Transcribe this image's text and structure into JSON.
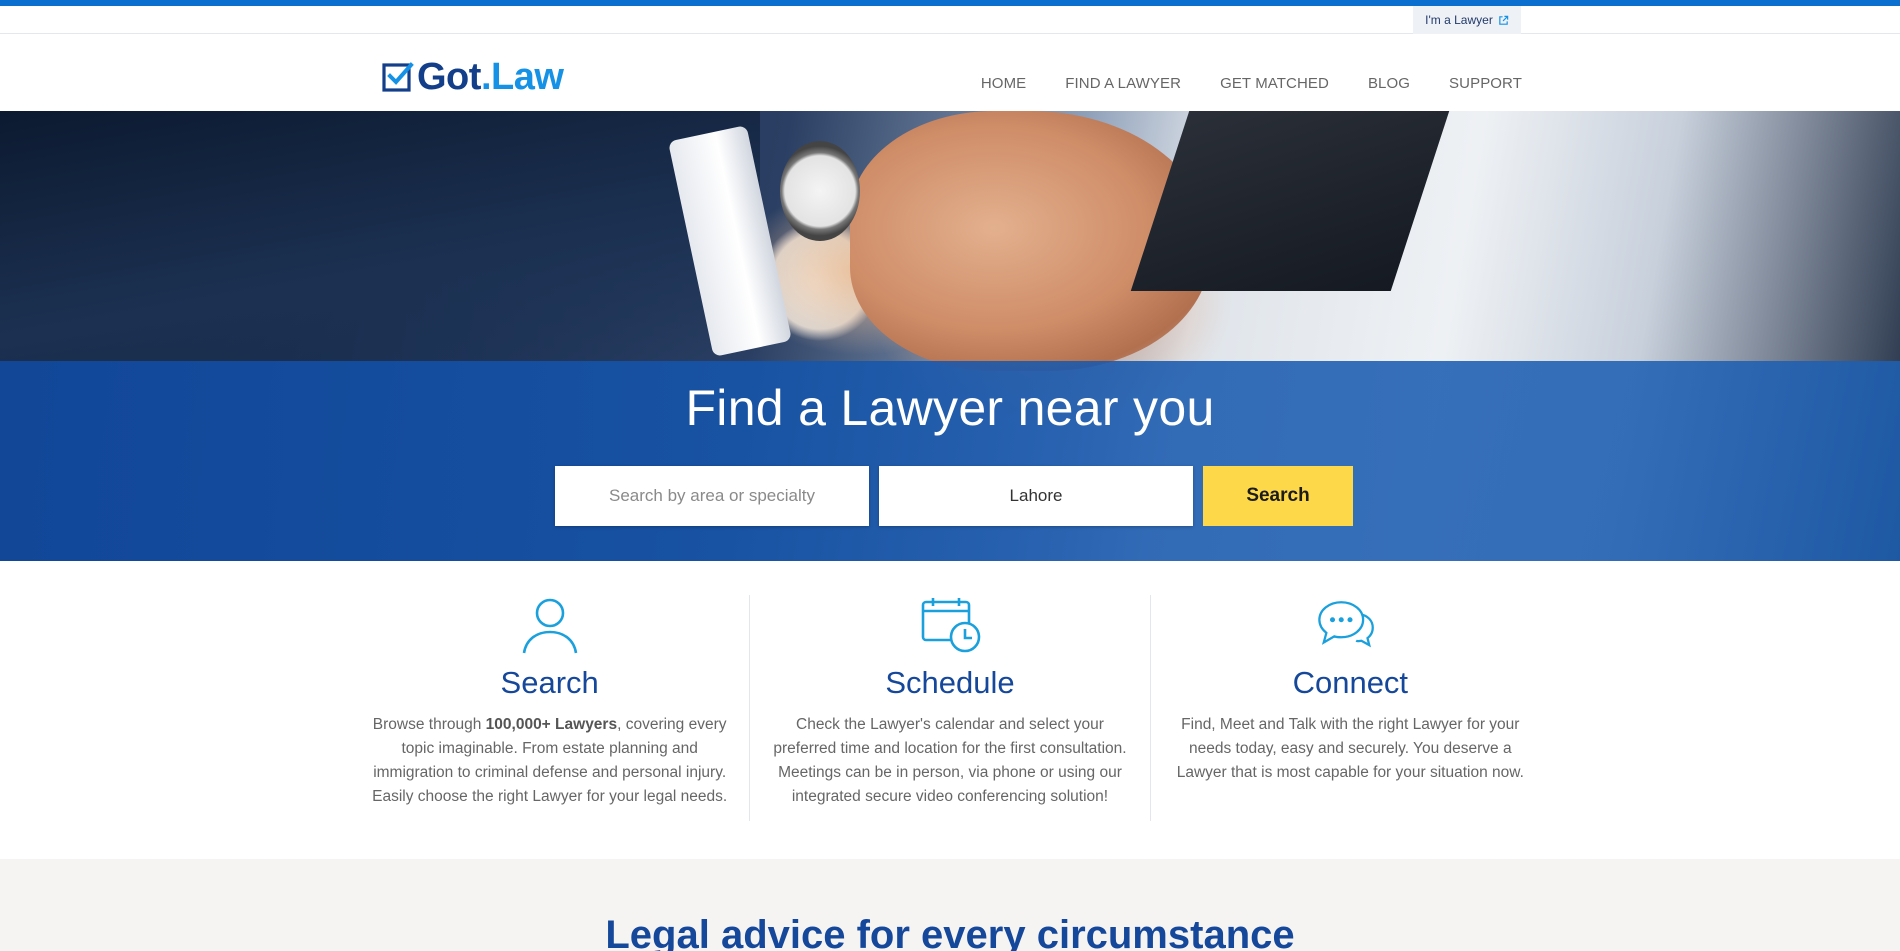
{
  "utility": {
    "lawyer_link": "I'm a Lawyer"
  },
  "brand": {
    "got": "Got",
    "law": ".Law"
  },
  "nav": {
    "home": "HOME",
    "find_lawyer": "FIND A LAWYER",
    "get_matched": "GET MATCHED",
    "blog": "BLOG",
    "support": "SUPPORT"
  },
  "hero": {
    "title": "Find a Lawyer near you",
    "search_placeholder": "Search by area or specialty",
    "location_value": "Lahore",
    "search_button": "Search"
  },
  "features": [
    {
      "icon": "user-icon",
      "title": "Search",
      "text_before": "Browse through ",
      "text_bold": "100,000+ Lawyers",
      "text_after": ", covering every topic imaginable. From estate planning and immigration to criminal defense and personal injury. Easily choose the right Lawyer for your legal needs."
    },
    {
      "icon": "calendar-clock-icon",
      "title": "Schedule",
      "text": "Check the Lawyer's calendar and select your preferred time and location for the first consultation. Meetings can be in person, via phone or using our integrated secure video conferencing solution!"
    },
    {
      "icon": "chat-bubbles-icon",
      "title": "Connect",
      "text": "Find, Meet and Talk with the right Lawyer for your needs today, easy and securely. You deserve a Lawyer that is most capable for your situation now."
    }
  ],
  "legal_section": {
    "title": "Legal advice for every circumstance"
  },
  "colors": {
    "accent": "#0a6fcf",
    "brand_dark": "#123e8a",
    "brand_light": "#1592e6",
    "hero_band": "#124aa0",
    "search_button": "#fdd94a",
    "feature_icon": "#1aa0dc"
  }
}
